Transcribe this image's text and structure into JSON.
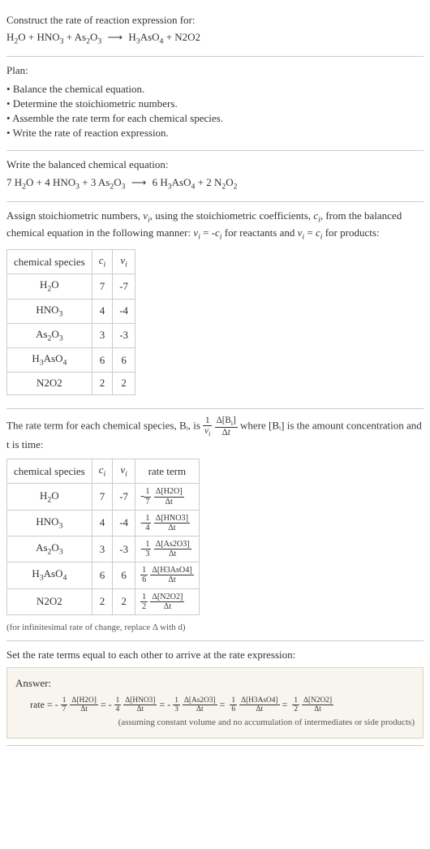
{
  "header": {
    "title": "Construct the rate of reaction expression for:",
    "equation_label": "H₂O + HNO₃ + As₂O₃ ⟶ H₃AsO₄ + N2O2"
  },
  "plan": {
    "title": "Plan:",
    "items": [
      "Balance the chemical equation.",
      "Determine the stoichiometric numbers.",
      "Assemble the rate term for each chemical species.",
      "Write the rate of reaction expression."
    ]
  },
  "balanced": {
    "title": "Write the balanced chemical equation:",
    "equation_label": "7 H₂O + 4 HNO₃ + 3 As₂O₃ ⟶ 6 H₃AsO₄ + 2 N₂O₂"
  },
  "stoich": {
    "text": "Assign stoichiometric numbers, νᵢ, using the stoichiometric coefficients, cᵢ, from the balanced chemical equation in the following manner: νᵢ = -cᵢ for reactants and νᵢ = cᵢ for products:",
    "headers": {
      "species": "chemical species",
      "ci": "cᵢ",
      "vi": "νᵢ"
    },
    "rows": [
      {
        "species": "H₂O",
        "ci": "7",
        "vi": "-7"
      },
      {
        "species": "HNO₃",
        "ci": "4",
        "vi": "-4"
      },
      {
        "species": "As₂O₃",
        "ci": "3",
        "vi": "-3"
      },
      {
        "species": "H₃AsO₄",
        "ci": "6",
        "vi": "6"
      },
      {
        "species": "N2O2",
        "ci": "2",
        "vi": "2"
      }
    ]
  },
  "rate_term_intro": {
    "prefix": "The rate term for each chemical species, Bᵢ, is ",
    "suffix": " where [Bᵢ] is the amount concentration and t is time:"
  },
  "rate_table": {
    "headers": {
      "species": "chemical species",
      "ci": "cᵢ",
      "vi": "νᵢ",
      "rate": "rate term"
    },
    "rows": [
      {
        "species": "H₂O",
        "ci": "7",
        "vi": "-7",
        "sign": "-",
        "coef_num": "1",
        "coef_den": "7",
        "conc": "Δ[H2O]",
        "den": "Δt"
      },
      {
        "species": "HNO₃",
        "ci": "4",
        "vi": "-4",
        "sign": "-",
        "coef_num": "1",
        "coef_den": "4",
        "conc": "Δ[HNO3]",
        "den": "Δt"
      },
      {
        "species": "As₂O₃",
        "ci": "3",
        "vi": "-3",
        "sign": "-",
        "coef_num": "1",
        "coef_den": "3",
        "conc": "Δ[As2O3]",
        "den": "Δt"
      },
      {
        "species": "H₃AsO₄",
        "ci": "6",
        "vi": "6",
        "sign": "",
        "coef_num": "1",
        "coef_den": "6",
        "conc": "Δ[H3AsO4]",
        "den": "Δt"
      },
      {
        "species": "N2O2",
        "ci": "2",
        "vi": "2",
        "sign": "",
        "coef_num": "1",
        "coef_den": "2",
        "conc": "Δ[N2O2]",
        "den": "Δt"
      }
    ],
    "note": "(for infinitesimal rate of change, replace Δ with d)"
  },
  "rate_expr": {
    "title": "Set the rate terms equal to each other to arrive at the rate expression:",
    "answer_label": "Answer:",
    "rate_prefix": "rate = ",
    "terms": [
      {
        "sign": "-",
        "num": "1",
        "den": "7",
        "conc": "Δ[H2O]",
        "tden": "Δt"
      },
      {
        "sign": "-",
        "num": "1",
        "den": "4",
        "conc": "Δ[HNO3]",
        "tden": "Δt"
      },
      {
        "sign": "-",
        "num": "1",
        "den": "3",
        "conc": "Δ[As2O3]",
        "tden": "Δt"
      },
      {
        "sign": "",
        "num": "1",
        "den": "6",
        "conc": "Δ[H3AsO4]",
        "tden": "Δt"
      },
      {
        "sign": "",
        "num": "1",
        "den": "2",
        "conc": "Δ[N2O2]",
        "tden": "Δt"
      }
    ],
    "eq": "=",
    "note": "(assuming constant volume and no accumulation of intermediates or side products)"
  },
  "formulas": {
    "H2O": {
      "base": "H",
      "s1": "2",
      "base2": "O"
    },
    "HNO3": {
      "base": "HNO",
      "s1": "3"
    },
    "As2O3": {
      "base": "As",
      "s1": "2",
      "base2": "O",
      "s2": "3"
    },
    "H3AsO4": {
      "base": "H",
      "s1": "3",
      "base2": "AsO",
      "s2": "4"
    },
    "N2O2": "N2O2"
  }
}
